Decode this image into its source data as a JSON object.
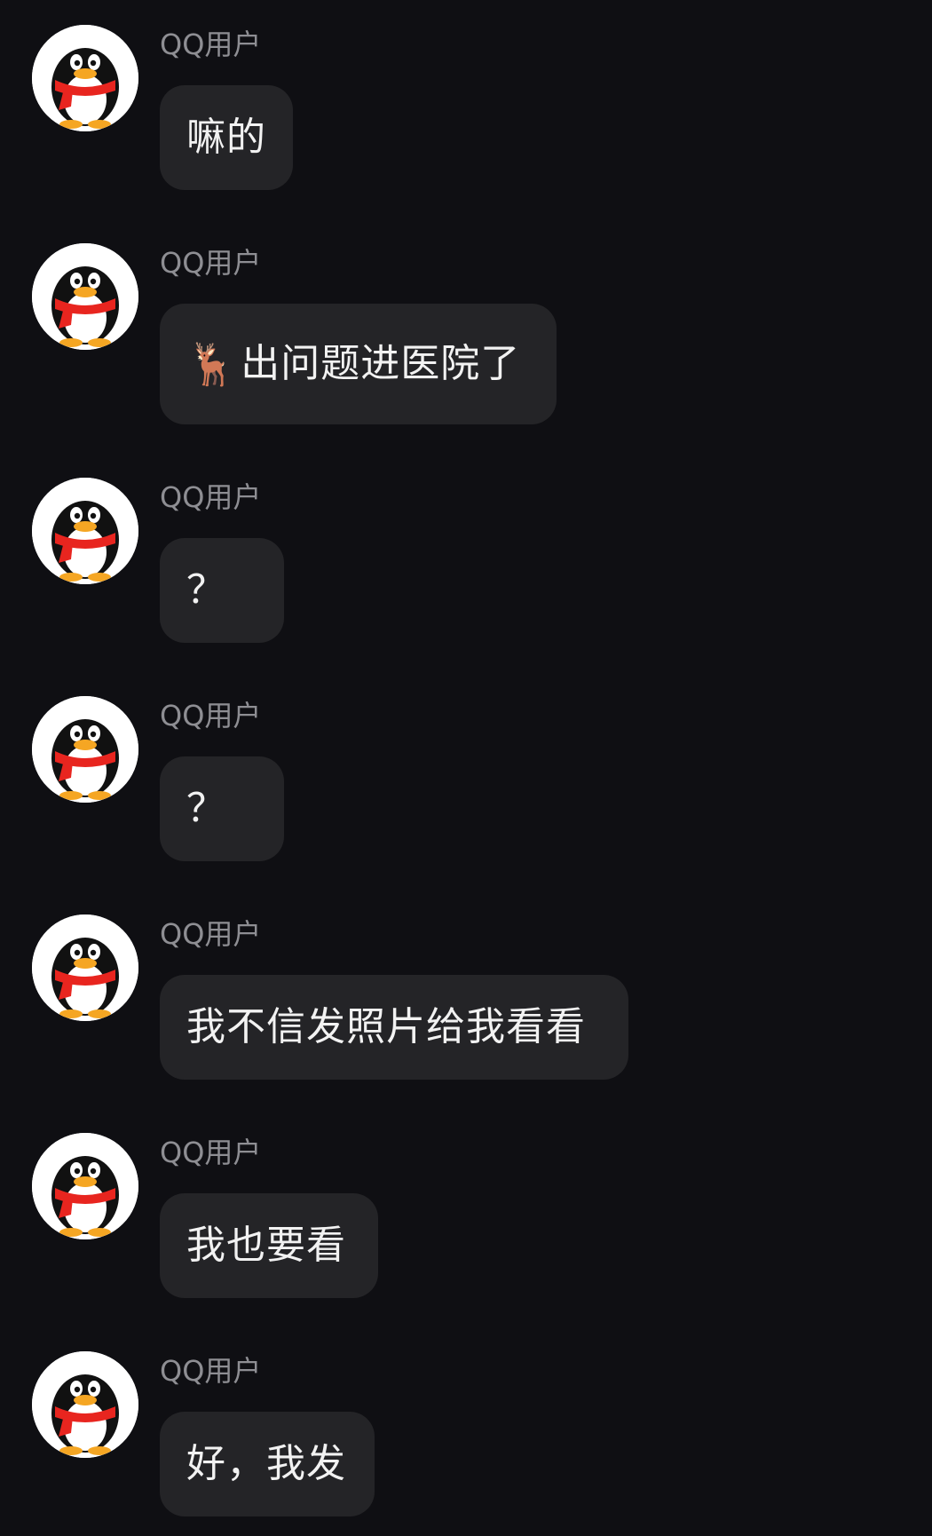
{
  "messages": [
    {
      "sender": "QQ用户",
      "text": "嘛的"
    },
    {
      "sender": "QQ用户",
      "emoji": "🦌",
      "text": "出问题进医院了"
    },
    {
      "sender": "QQ用户",
      "text": "？"
    },
    {
      "sender": "QQ用户",
      "text": "？"
    },
    {
      "sender": "QQ用户",
      "text": "我不信发照片给我看看"
    },
    {
      "sender": "QQ用户",
      "text": "我也要看"
    },
    {
      "sender": "QQ用户",
      "text": "好，我发"
    }
  ],
  "avatar_icon": "qq-penguin-icon",
  "colors": {
    "background": "#0f0f13",
    "bubble": "#242427",
    "sender_text": "#8e8e93",
    "message_text": "#f2f2f2",
    "penguin_scarf": "#e8251f",
    "penguin_beak": "#f5a623"
  }
}
